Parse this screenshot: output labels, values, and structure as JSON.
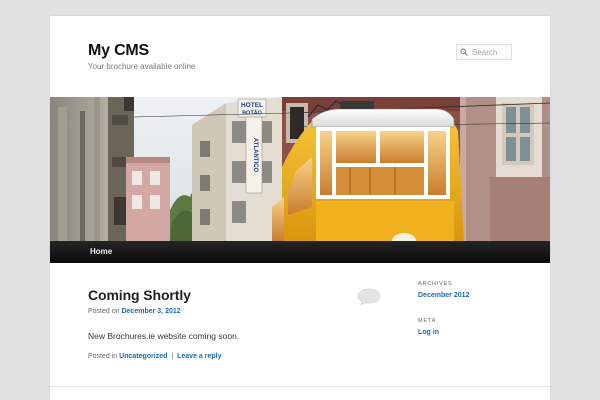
{
  "site": {
    "title": "My CMS",
    "description": "Your brochure available online"
  },
  "search": {
    "placeholder": "Search",
    "icon": "search-icon"
  },
  "banner": {
    "hotel_sign": "HOTEL",
    "sign_name": "BOTÃO",
    "sign_vertical": "ATLANTICO"
  },
  "nav": {
    "items": [
      {
        "label": "Home"
      }
    ]
  },
  "post": {
    "title": "Coming Shortly",
    "posted_on_prefix": "Posted on",
    "date": "December 3, 2012",
    "content": "New Brochures.ie website coming soon.",
    "posted_in_prefix": "Posted in",
    "category": "Uncategorized",
    "separator": "|",
    "reply_link": "Leave a reply",
    "comment_icon": "comment-bubble-icon"
  },
  "sidebar": {
    "archives": {
      "title": "ARCHIVES",
      "items": [
        "December 2012"
      ]
    },
    "meta": {
      "title": "META",
      "items": [
        "Log in"
      ]
    }
  },
  "colors": {
    "link": "#1b6ab1",
    "nav_background": "#111111",
    "page_background": "#e2e2e2",
    "tram_yellow": "#f0b21a"
  }
}
